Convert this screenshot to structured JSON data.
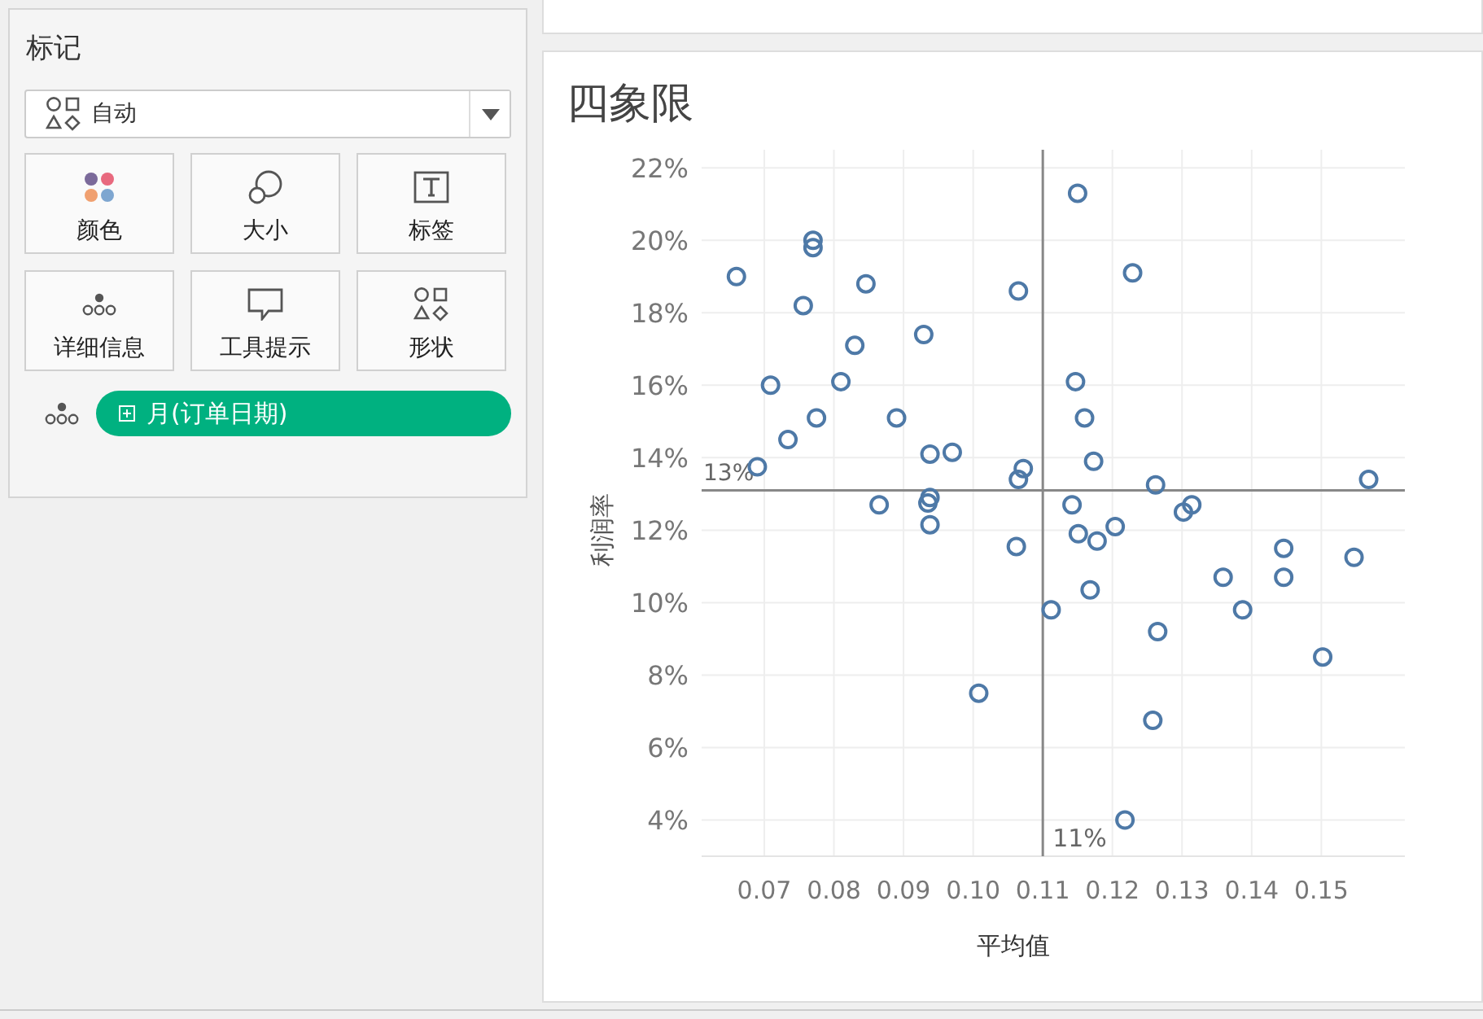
{
  "marks_panel": {
    "title": "标记",
    "mark_type": {
      "value": "自动"
    },
    "cards": [
      {
        "label": "颜色",
        "kind": "color"
      },
      {
        "label": "大小",
        "kind": "size"
      },
      {
        "label": "标签",
        "kind": "label"
      },
      {
        "label": "详细信息",
        "kind": "detail"
      },
      {
        "label": "工具提示",
        "kind": "tooltip"
      },
      {
        "label": "形状",
        "kind": "shape"
      }
    ],
    "fields": [
      {
        "label": "月(订单日期)",
        "kind": "detail"
      }
    ]
  },
  "sheet": {
    "title": "四象限",
    "chart_data": {
      "type": "scatter",
      "xlabel": "平均值",
      "ylabel": "利润率",
      "xlim": [
        0.061,
        0.162
      ],
      "ylim": [
        3,
        22.5
      ],
      "xticks": [
        {
          "value": 0.07,
          "label": "0.07"
        },
        {
          "value": 0.08,
          "label": "0.08"
        },
        {
          "value": 0.09,
          "label": "0.09"
        },
        {
          "value": 0.1,
          "label": "0.10"
        },
        {
          "value": 0.11,
          "label": "0.11"
        },
        {
          "value": 0.12,
          "label": "0.12"
        },
        {
          "value": 0.13,
          "label": "0.13"
        },
        {
          "value": 0.14,
          "label": "0.14"
        },
        {
          "value": 0.15,
          "label": "0.15"
        }
      ],
      "yticks": [
        {
          "value": 4,
          "label": "4%"
        },
        {
          "value": 6,
          "label": "6%"
        },
        {
          "value": 8,
          "label": "8%"
        },
        {
          "value": 10,
          "label": "10%"
        },
        {
          "value": 12,
          "label": "12%"
        },
        {
          "value": 14,
          "label": "14%"
        },
        {
          "value": 16,
          "label": "16%"
        },
        {
          "value": 18,
          "label": "18%"
        },
        {
          "value": 20,
          "label": "20%"
        },
        {
          "value": 22,
          "label": "22%"
        }
      ],
      "x": [
        0.066,
        0.077,
        0.077,
        0.0756,
        0.0846,
        0.0709,
        0.083,
        0.081,
        0.0734,
        0.0775,
        0.069,
        0.089,
        0.0929,
        0.0938,
        0.097,
        0.0865,
        0.0938,
        0.0935,
        0.0938,
        0.1008,
        0.1065,
        0.1072,
        0.1065,
        0.1062,
        0.1112,
        0.115,
        0.1147,
        0.116,
        0.1173,
        0.1142,
        0.1151,
        0.1178,
        0.1168,
        0.1204,
        0.1229,
        0.1262,
        0.1302,
        0.1314,
        0.1265,
        0.1258,
        0.1218,
        0.1359,
        0.1387,
        0.1446,
        0.1446,
        0.1547,
        0.1502,
        0.1568
      ],
      "series": [
        {
          "color": "#4e79a7",
          "values": [
            19.0,
            19.8,
            20.0,
            18.2,
            18.8,
            16.0,
            17.1,
            16.1,
            14.5,
            15.1,
            13.75,
            15.1,
            17.4,
            14.1,
            14.15,
            12.7,
            12.9,
            12.75,
            12.15,
            7.5,
            18.6,
            13.7,
            13.4,
            11.55,
            9.8,
            21.3,
            16.1,
            15.1,
            13.9,
            12.7,
            11.9,
            11.7,
            10.35,
            12.1,
            19.1,
            13.25,
            12.5,
            12.7,
            9.2,
            6.75,
            4.0,
            10.7,
            9.8,
            11.5,
            10.7,
            11.25,
            8.5,
            13.4
          ]
        }
      ],
      "grid": true,
      "ref_lines": [
        {
          "axis": "y",
          "value": 13.1,
          "label": "13%"
        },
        {
          "axis": "x",
          "value": 0.11,
          "label": "11%"
        }
      ]
    }
  }
}
